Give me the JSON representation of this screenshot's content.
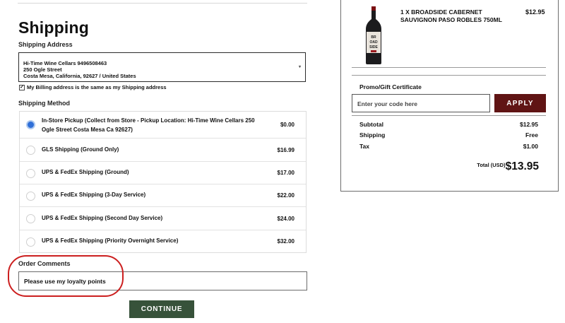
{
  "shipping": {
    "title": "Shipping",
    "address_label": "Shipping Address",
    "address_lines": [
      "Hi-Time Wine Cellars 9496508463",
      "250 Ogle Street",
      "Costa Mesa, California, 92627 / United States"
    ],
    "address_caret": "▾",
    "billing_same_checked": true,
    "billing_same_label": "My Billing address is the same as my Shipping address",
    "method_label": "Shipping Method",
    "methods": [
      {
        "label": "In-Store Pickup (Collect from Store - Pickup Location: Hi-Time Wine Cellars 250 Ogle Street Costa Mesa Ca 92627)",
        "price": "$0.00",
        "selected": true
      },
      {
        "label": "GLS Shipping (Ground Only)",
        "price": "$16.99",
        "selected": false
      },
      {
        "label": "UPS & FedEx Shipping (Ground)",
        "price": "$17.00",
        "selected": false
      },
      {
        "label": "UPS & FedEx Shipping (3-Day Service)",
        "price": "$22.00",
        "selected": false
      },
      {
        "label": "UPS & FedEx Shipping (Second Day Service)",
        "price": "$24.00",
        "selected": false
      },
      {
        "label": "UPS & FedEx Shipping (Priority Overnight Service)",
        "price": "$32.00",
        "selected": false
      }
    ],
    "comments_label": "Order Comments",
    "comments_value": "Please use my loyalty points",
    "continue_label": "CONTINUE"
  },
  "summary": {
    "item_title": "1 X BROADSIDE CABERNET SAUVIGNON PASO ROBLES 750ML",
    "item_price": "$12.95",
    "bottle_label_text": "BROADSIDE",
    "promo_label": "Promo/Gift Certificate",
    "promo_placeholder": "Enter your code here",
    "apply_label": "APPLY",
    "subtotal_label": "Subtotal",
    "subtotal_value": "$12.95",
    "shipping_label": "Shipping",
    "shipping_value": "Free",
    "tax_label": "Tax",
    "tax_value": "$1.00",
    "total_label": "Total (USD)",
    "total_value": "$13.95"
  },
  "colors": {
    "continue_bg": "#37523a",
    "apply_bg": "#601414",
    "radio_selected": "#2f6fd8",
    "annotation": "#cc1f1f"
  }
}
